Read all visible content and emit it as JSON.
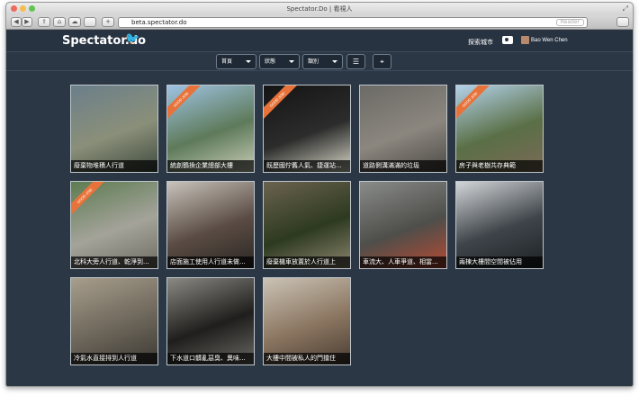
{
  "browser": {
    "title": "Spectator.Do | 看視人",
    "url": "beta.spectator.do",
    "reader_label": "Reader",
    "nav_back": "◀",
    "nav_forward": "▶",
    "share": "⇪",
    "home": "⌂",
    "cloud": "☁",
    "plus": "+",
    "fullscreen": "⤢",
    "traffic_colors": [
      "#ee6a5f",
      "#f5bd4f",
      "#61c454"
    ]
  },
  "header": {
    "logo": "Spectator.do",
    "explore_label": "探索城市",
    "username": "Bao Wen Chen"
  },
  "filters": {
    "home": "首頁",
    "state": "狀態",
    "category": "類別",
    "list_icon": "☰",
    "map_icon": "⌖"
  },
  "tiles": [
    {
      "caption": "廢棄物堆積人行道",
      "ribbon": false,
      "colors": [
        "#6b7f8a",
        "#8a8f79",
        "#3f4a3e"
      ]
    },
    {
      "caption": "統創鶴換企業總部大樓",
      "ribbon": true,
      "ribbon_text": "GOOD JOB!",
      "colors": [
        "#9ec3e2",
        "#5e7a5a",
        "#c9cdb6"
      ]
    },
    {
      "caption": "既歷國佇舊人氣、捷運站...",
      "ribbon": true,
      "ribbon_text": "GOOD JOB!",
      "colors": [
        "#141414",
        "#2c2c2c",
        "#d8d8c8"
      ]
    },
    {
      "caption": "道路側溝滿滿的垃圾",
      "ribbon": false,
      "colors": [
        "#6c6a66",
        "#8b877f",
        "#4c4844"
      ]
    },
    {
      "caption": "房子與老樹共存典範",
      "ribbon": true,
      "ribbon_text": "GOOD JOB!",
      "colors": [
        "#b3d2ea",
        "#5a6f46",
        "#7b6a57"
      ]
    },
    {
      "caption": "北科大旁人行道、乾淨到...",
      "ribbon": true,
      "ribbon_text": "GOOD JOB!",
      "colors": [
        "#5d7c51",
        "#a4a39a",
        "#6e6c62"
      ]
    },
    {
      "caption": "店面施工使用人行道未做...",
      "ribbon": false,
      "colors": [
        "#c8c3bb",
        "#5a4c44",
        "#2b2623"
      ]
    },
    {
      "caption": "廢棄機車放置於人行道上",
      "ribbon": false,
      "colors": [
        "#6b6250",
        "#2d3a1f",
        "#8d8570"
      ]
    },
    {
      "caption": "車流大、人車爭道、相當...",
      "ribbon": false,
      "colors": [
        "#8a8c8a",
        "#4e4e4a",
        "#b64a33"
      ]
    },
    {
      "caption": "兩棟大樓間空間被佔用",
      "ribbon": false,
      "colors": [
        "#d3d6d8",
        "#3e4449",
        "#1d2226"
      ]
    },
    {
      "caption": "冷氣水直接排到人行道",
      "ribbon": false,
      "colors": [
        "#a79e8c",
        "#6d665a",
        "#3c3a35"
      ]
    },
    {
      "caption": "下水道口髒亂惡臭、異味...",
      "ribbon": false,
      "colors": [
        "#8b8983",
        "#1f1e1c",
        "#6a6864"
      ]
    },
    {
      "caption": "大樓中間被私人的門擋住",
      "ribbon": false,
      "colors": [
        "#cbc3b6",
        "#8a7560",
        "#4a3d33"
      ]
    }
  ]
}
